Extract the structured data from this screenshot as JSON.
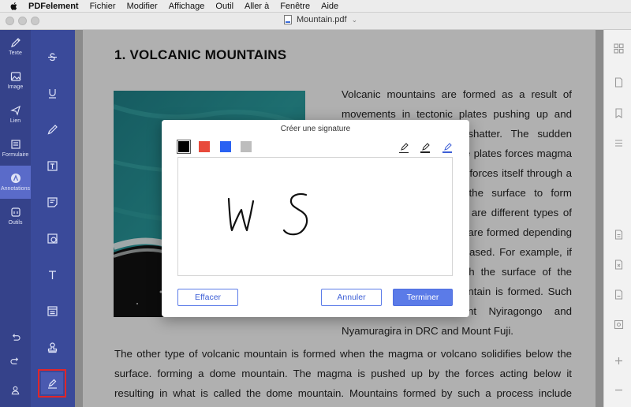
{
  "menubar": {
    "app_name": "PDFelement",
    "items": [
      "Fichier",
      "Modifier",
      "Affichage",
      "Outil",
      "Aller à",
      "Fenêtre",
      "Aide"
    ]
  },
  "window": {
    "file_name": "Mountain.pdf"
  },
  "sidebar": {
    "items": [
      {
        "label": "Texte",
        "icon": "pencil-icon"
      },
      {
        "label": "Image",
        "icon": "image-icon"
      },
      {
        "label": "Lien",
        "icon": "link-icon"
      },
      {
        "label": "Formulaire",
        "icon": "form-icon"
      },
      {
        "label": "Annotations",
        "icon": "annotation-icon",
        "active": true
      },
      {
        "label": "Outils",
        "icon": "tools-icon"
      }
    ],
    "bottom_icons": [
      "undo-icon",
      "redo-icon",
      "account-icon"
    ]
  },
  "tools": [
    "strikethrough-icon",
    "underline-icon",
    "pencil-icon",
    "textbox-icon",
    "sticky-note-icon",
    "shape-icon",
    "text-icon",
    "area-icon",
    "stamp-icon",
    "signature-icon"
  ],
  "document": {
    "heading": "1. VOLCANIC MOUNTAINS",
    "right_column": "Volcanic mountains are formed as a result of movements in tectonic plates pushing up and causing the ground to shatter. The sudden random movement of these plates forces magma to the surface, the magma forces itself through a vent and spreads onto the surface to form volcanic mountains. There are different types of volcanic mountains, which are formed depending on how the magma is released. For example, if the magma erupts through the surface of the earth a stratovolcano mountain is formed. Such mountains include Mount Nyiragongo and Nyamuragira in DRC and Mount Fuji.",
    "full_width": "The other type of volcanic mountain is formed when the magma or volcano solidifies below the surface. forming a dome mountain. The magma is pushed up by the forces acting below it resulting in what is called the dome mountain. Mountains formed by such a process include Torfajokull in Iceland"
  },
  "dialog": {
    "title": "Créer une signature",
    "colors": [
      "#000000",
      "#e84a3b",
      "#2a62f2",
      "#bdbdbd"
    ],
    "selected_color": "#000000",
    "pen_styles": [
      "pen-thin-icon",
      "pen-medium-icon",
      "pen-thick-icon"
    ],
    "signature_text": "W S",
    "clear_label": "Effacer",
    "cancel_label": "Annuler",
    "done_label": "Terminer"
  },
  "right_panel": {
    "icons": [
      "grid-icon",
      "page-icon",
      "bookmark-icon",
      "list-icon",
      "ocr-icon",
      "compress-icon",
      "pdf-icon",
      "image-convert-icon",
      "zoom-in-icon",
      "zoom-out-icon"
    ]
  }
}
